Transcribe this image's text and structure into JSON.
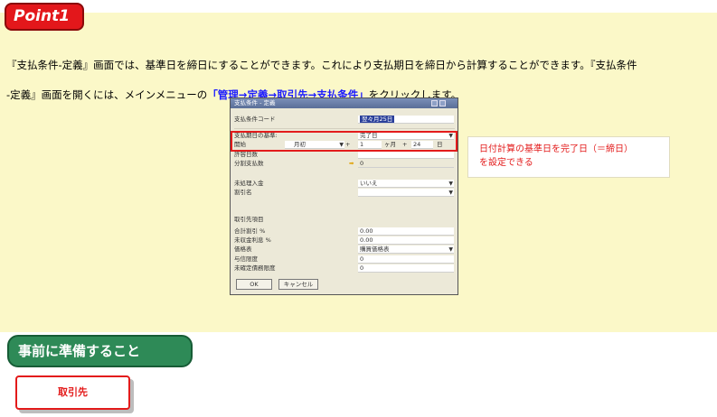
{
  "point": {
    "badge": "Point1",
    "line1": "『支払条件-定義』画面では、基準日を締日にすることができます。これにより支払期日を締日から計算することができます。『支払条件",
    "line2_prefix": "-定義』画面を開くには、メインメニューの",
    "line2_link": "「管理→定義→取引先→支払条件」",
    "line2_suffix": "をクリックします。"
  },
  "dialog": {
    "title": "支払条件 - 定義",
    "code_label": "支払条件コード",
    "code_value": "翌々月25日",
    "due_basis_label": "支払期日の基準:",
    "due_basis_value": "完了日",
    "start_label": "開始",
    "start_value": "月初",
    "plus1": "+",
    "plus_num": "1",
    "month_unit": "ヶ月",
    "plus2": "+",
    "day_num": "24",
    "day_unit": "日",
    "tolerance_label": "許容日数",
    "installments_label": "分割支払数",
    "installments_value": "0",
    "open_incoming_label": "未処理入金",
    "open_incoming_value": "いいえ",
    "discount_label": "割引名",
    "bp_section": "取引先項目",
    "total_discount_label": "合計割引 %",
    "total_discount_value": "0.00",
    "interest_label": "未収金利息 %",
    "interest_value": "0.00",
    "price_list_label": "価格表",
    "price_list_value": "購買価格表",
    "credit_limit_label": "与信限度",
    "credit_limit_value": "0",
    "commit_limit_label": "未確定債務限度",
    "commit_limit_value": "0",
    "ok": "OK",
    "cancel": "キャンセル"
  },
  "callout": {
    "line1": "日付計算の基準日を完了日（＝締日）",
    "line2": "を設定できる"
  },
  "prep_heading": "事前に準備すること",
  "torihiki_button": "取引先"
}
